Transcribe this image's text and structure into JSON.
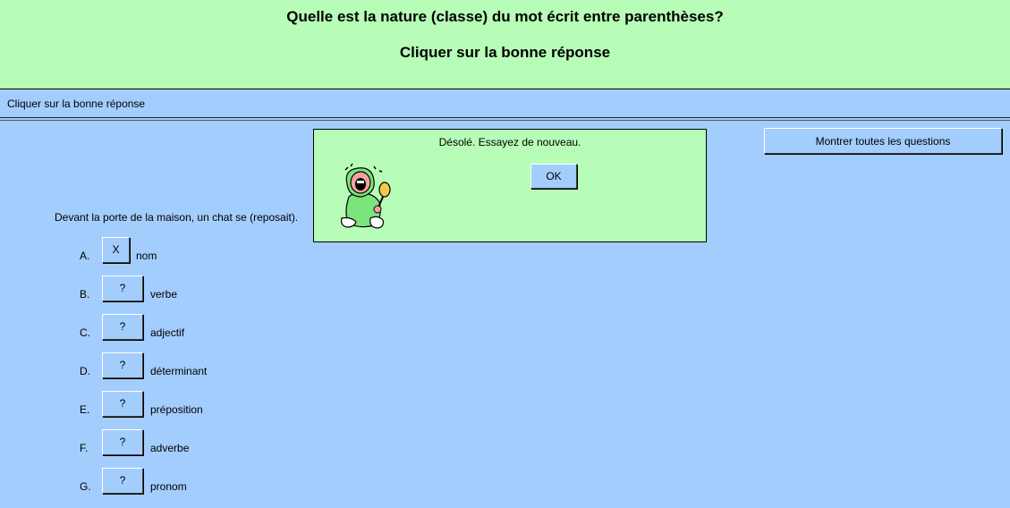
{
  "header": {
    "title": "Quelle est la nature (classe) du mot écrit entre parenthèses?",
    "subtitle": "Cliquer sur la bonne réponse"
  },
  "instruction": "Cliquer sur la bonne réponse",
  "show_all_label": "Montrer toutes les questions",
  "question": "Devant la porte de la maison, un chat se (reposait).",
  "options": [
    {
      "letter": "A.",
      "button": "X",
      "label": "nom"
    },
    {
      "letter": "B.",
      "button": "?",
      "label": "verbe"
    },
    {
      "letter": "C.",
      "button": "?",
      "label": "adjectif"
    },
    {
      "letter": "D.",
      "button": "?",
      "label": "déterminant"
    },
    {
      "letter": "E.",
      "button": "?",
      "label": "préposition"
    },
    {
      "letter": "F.",
      "button": "?",
      "label": "adverbe"
    },
    {
      "letter": "G.",
      "button": "?",
      "label": "pronom"
    }
  ],
  "dialog": {
    "message": "Désolé. Essayez de nouveau.",
    "ok_label": "OK",
    "icon": "crying-baby-icon"
  },
  "colors": {
    "header_bg": "#b7fdb7",
    "page_bg": "#a3cdfd",
    "dialog_bg": "#b7fdb7"
  }
}
